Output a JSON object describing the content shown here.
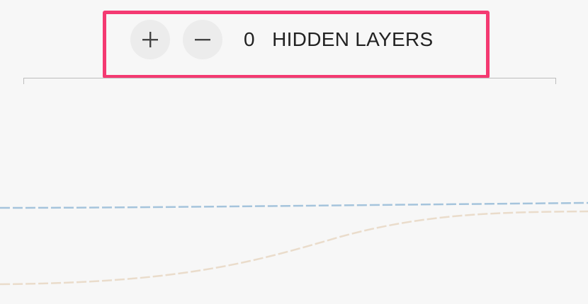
{
  "controls": {
    "add_icon": "plus-icon",
    "remove_icon": "minus-icon",
    "hidden_layer_count": "0",
    "hidden_layers_label": "HIDDEN LAYERS"
  },
  "colors": {
    "highlight": "#f43a72",
    "button_bg": "#ececec",
    "curve_blue": "#a5c4dc",
    "curve_tan": "#eadccb"
  }
}
